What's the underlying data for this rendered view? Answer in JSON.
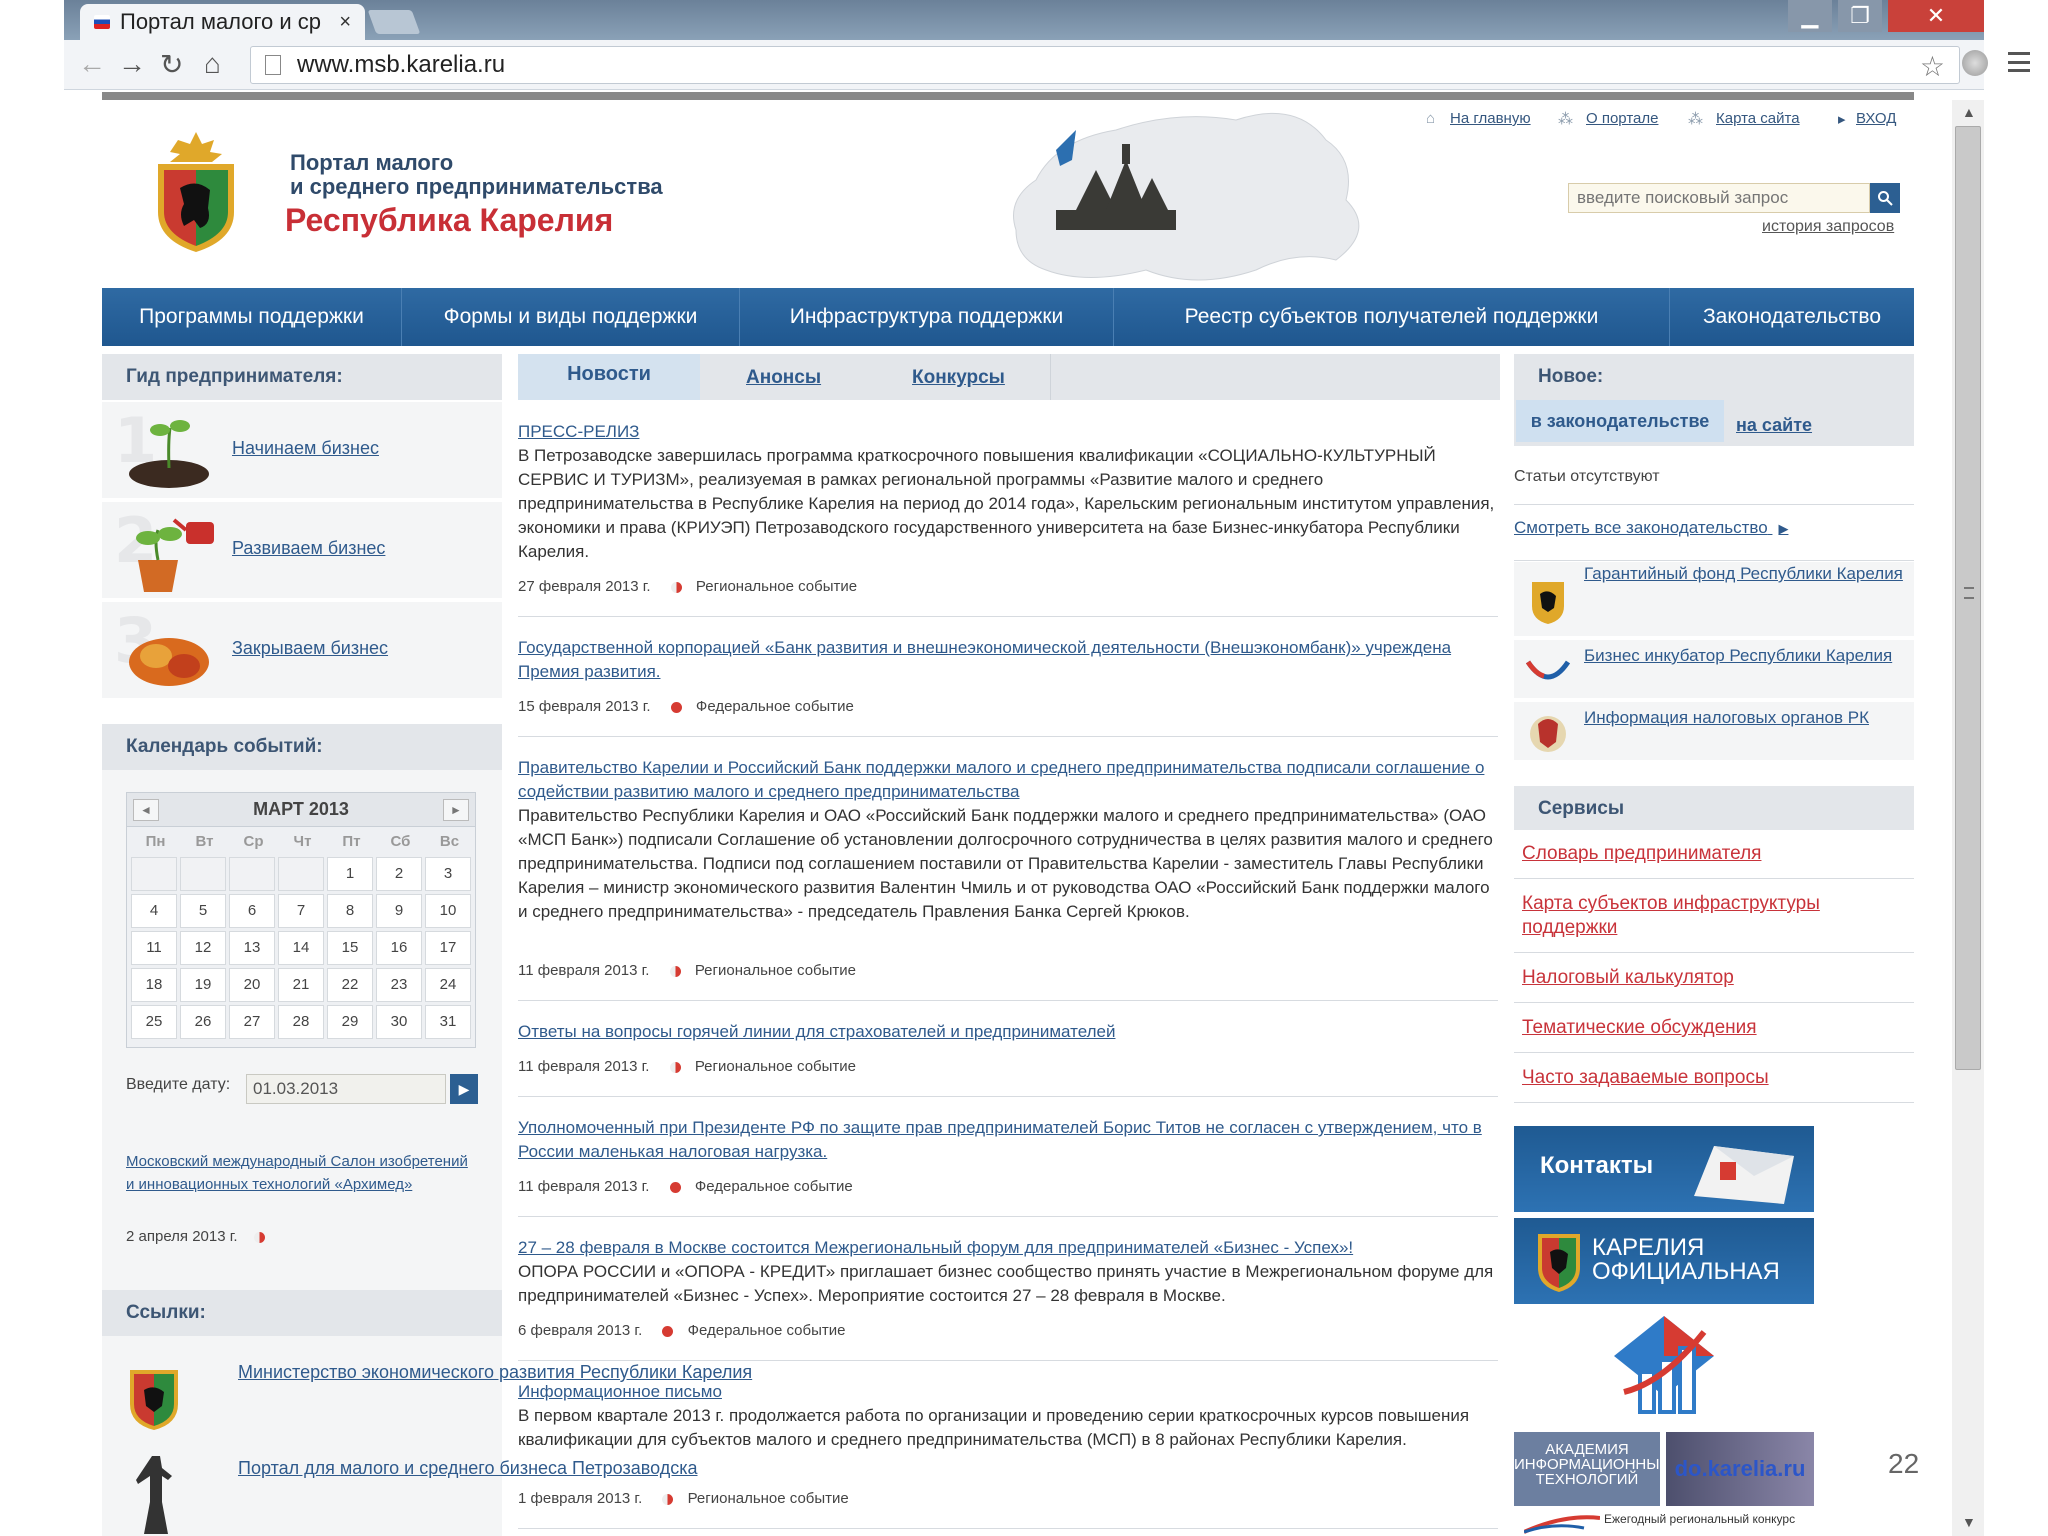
{
  "browser": {
    "tab_title": "Портал малого и ср",
    "tab_close": "×",
    "url": "www.msb.karelia.ru",
    "min_glyph": "▁",
    "max_glyph": "❐",
    "close_glyph": "✕"
  },
  "header": {
    "title_line1": "Портал малого",
    "title_line2": "и среднего предпринимательства",
    "title_line3": "Республика Карелия",
    "top_links": {
      "home": "На главную",
      "about": "О портале",
      "sitemap": "Карта сайта",
      "login": "ВХОД"
    },
    "search": {
      "placeholder": "введите поисковый запрос",
      "history": "история запросов"
    }
  },
  "nav": {
    "items": [
      {
        "label": "Программы поддержки"
      },
      {
        "label": "Формы и виды поддержки"
      },
      {
        "label": "Инфраструктура поддержки"
      },
      {
        "label": "Реестр субъектов получателей поддержки"
      },
      {
        "label": "Законодательство"
      }
    ]
  },
  "guide": {
    "heading": "Гид предпринимателя:",
    "items": [
      {
        "num": "1",
        "label": "Начинаем бизнес"
      },
      {
        "num": "2",
        "label": "Развиваем бизнес"
      },
      {
        "num": "3",
        "label": "Закрываем бизнес"
      }
    ]
  },
  "calendar": {
    "heading": "Календарь событий:",
    "month": "МАРТ 2013",
    "prev": "◄",
    "next": "►",
    "weekdays": [
      "Пн",
      "Вт",
      "Ср",
      "Чт",
      "Пт",
      "Сб",
      "Вс"
    ],
    "weeks": [
      [
        "",
        "",
        "",
        "",
        "1",
        "2",
        "3"
      ],
      [
        "4",
        "5",
        "6",
        "7",
        "8",
        "9",
        "10"
      ],
      [
        "11",
        "12",
        "13",
        "14",
        "15",
        "16",
        "17"
      ],
      [
        "18",
        "19",
        "20",
        "21",
        "22",
        "23",
        "24"
      ],
      [
        "25",
        "26",
        "27",
        "28",
        "29",
        "30",
        "31"
      ]
    ],
    "date_label": "Введите дату:",
    "date_value": "01.03.2013",
    "event_link": "Московский международный Салон изобретений и инновационных технологий «Архимед»",
    "event_date": "2 апреля 2013 г."
  },
  "links": {
    "heading": "Ссылки:",
    "items": [
      {
        "label": "Министерство экономического развития Республики Карелия"
      },
      {
        "label": "Портал для малого и среднего бизнеса Петрозаводска"
      }
    ]
  },
  "center": {
    "tabs": {
      "news": "Новости",
      "announcements": "Анонсы",
      "contests": "Конкурсы"
    },
    "news": [
      {
        "title": "ПРЕСС-РЕЛИЗ",
        "body": "В Петрозаводске завершилась программа краткосрочного повышения квалификации «СОЦИАЛЬНО-КУЛЬТУРНЫЙ СЕРВИС И ТУРИЗМ», реализуемая в рамках региональной программы «Развитие малого и среднего предпринимательства в Республике Карелия на период до 2014 года», Карельским региональным институтом управления, экономики и права (КРИУЭП) Петрозаводского государственного университета на базе Бизнес-инкубатора Республики Карелия.",
        "date": "27 февраля 2013 г.",
        "category": "Региональное событие"
      },
      {
        "title": "Государственной корпорацией «Банк развития и внешнеэкономической деятельности (Внешэкономбанк)» учреждена Премия развития.",
        "body": "",
        "date": "15 февраля 2013 г.",
        "category": "Федеральное событие"
      },
      {
        "title": "Правительство Карелии и Российский Банк поддержки малого и среднего предпринимательства подписали соглашение о содействии развитию малого и среднего предпринимательства",
        "body": "Правительство Республики Карелия и ОАО «Российский Банк поддержки малого и среднего предпринимательства» (ОАО «МСП Банк») подписали Соглашение об установлении долгосрочного сотрудничества в целях развития малого и среднего предпринимательства. Подписи под соглашением поставили от Правительства Карелии - заместитель Главы Республики Карелия – министр экономического развития Валентин Чмиль и от руководства ОАО «Российский Банк поддержки малого и среднего предпринимательства» - председатель Правления Банка Сергей Крюков.",
        "date": "11 февраля 2013 г.",
        "category": "Региональное событие"
      },
      {
        "title": "Ответы на вопросы горячей линии для страхователей и предпринимателей",
        "body": "",
        "date": "11 февраля 2013 г.",
        "category": "Региональное событие"
      },
      {
        "title": "Уполномоченный при Президенте РФ по защите прав предпринимателей Борис Титов не согласен с утверждением, что в России маленькая налоговая нагрузка.",
        "body": "",
        "date": "11 февраля 2013 г.",
        "category": "Федеральное событие"
      },
      {
        "title": "27 – 28 февраля в Москве состоится Межрегиональный форум для предпринимателей «Бизнес - Успех»!",
        "body": "ОПОРА РОССИИ и «ОПОРА - КРЕДИТ» приглашает бизнес сообщество принять участие в Межрегиональном форуме для предпринимателей «Бизнес - Успех». Мероприятие состоится 27 – 28 февраля в Москве.",
        "date": "6 февраля 2013 г.",
        "category": "Федеральное событие"
      },
      {
        "title": "Информационное письмо",
        "body": "В первом квартале 2013 г. продолжается работа по организации и проведению серии краткосрочных курсов повышения квалификации для субъектов малого и среднего предпринимательства (МСП) в 8 районах Республики Карелия.",
        "date": "1 февраля 2013 г.",
        "category": "Региональное событие"
      }
    ]
  },
  "right": {
    "new_heading": "Новое:",
    "subtab_law": "в законодательстве",
    "subtab_site": "на сайте",
    "no_articles": "Статьи отсутствуют",
    "see_all": "Смотреть все законодательство",
    "partners": [
      {
        "label": "Гарантийный фонд Республики Карелия"
      },
      {
        "label": "Бизнес инкубатор Республики Карелия"
      },
      {
        "label": "Информация налоговых органов РК"
      }
    ],
    "services_heading": "Сервисы",
    "services": [
      {
        "label": "Словарь предпринимателя"
      },
      {
        "label": "Карта субъектов инфраструктуры поддержки"
      },
      {
        "label": "Налоговый калькулятор"
      },
      {
        "label": "Тематические обсуждения"
      },
      {
        "label": "Часто задаваемые вопросы"
      }
    ],
    "banners": {
      "contacts": "Контакты",
      "karelia_line1": "КАРЕЛИЯ",
      "karelia_line2": "ОФИЦИАЛЬНАЯ",
      "academy": "АКАДЕМИЯ ИНФОРМАЦИОННЫХ ТЕХНОЛОГИЙ",
      "do_karelia": "do.karelia.ru",
      "contest": "Ежегодный региональный конкурс"
    }
  },
  "slide_number": "22"
}
